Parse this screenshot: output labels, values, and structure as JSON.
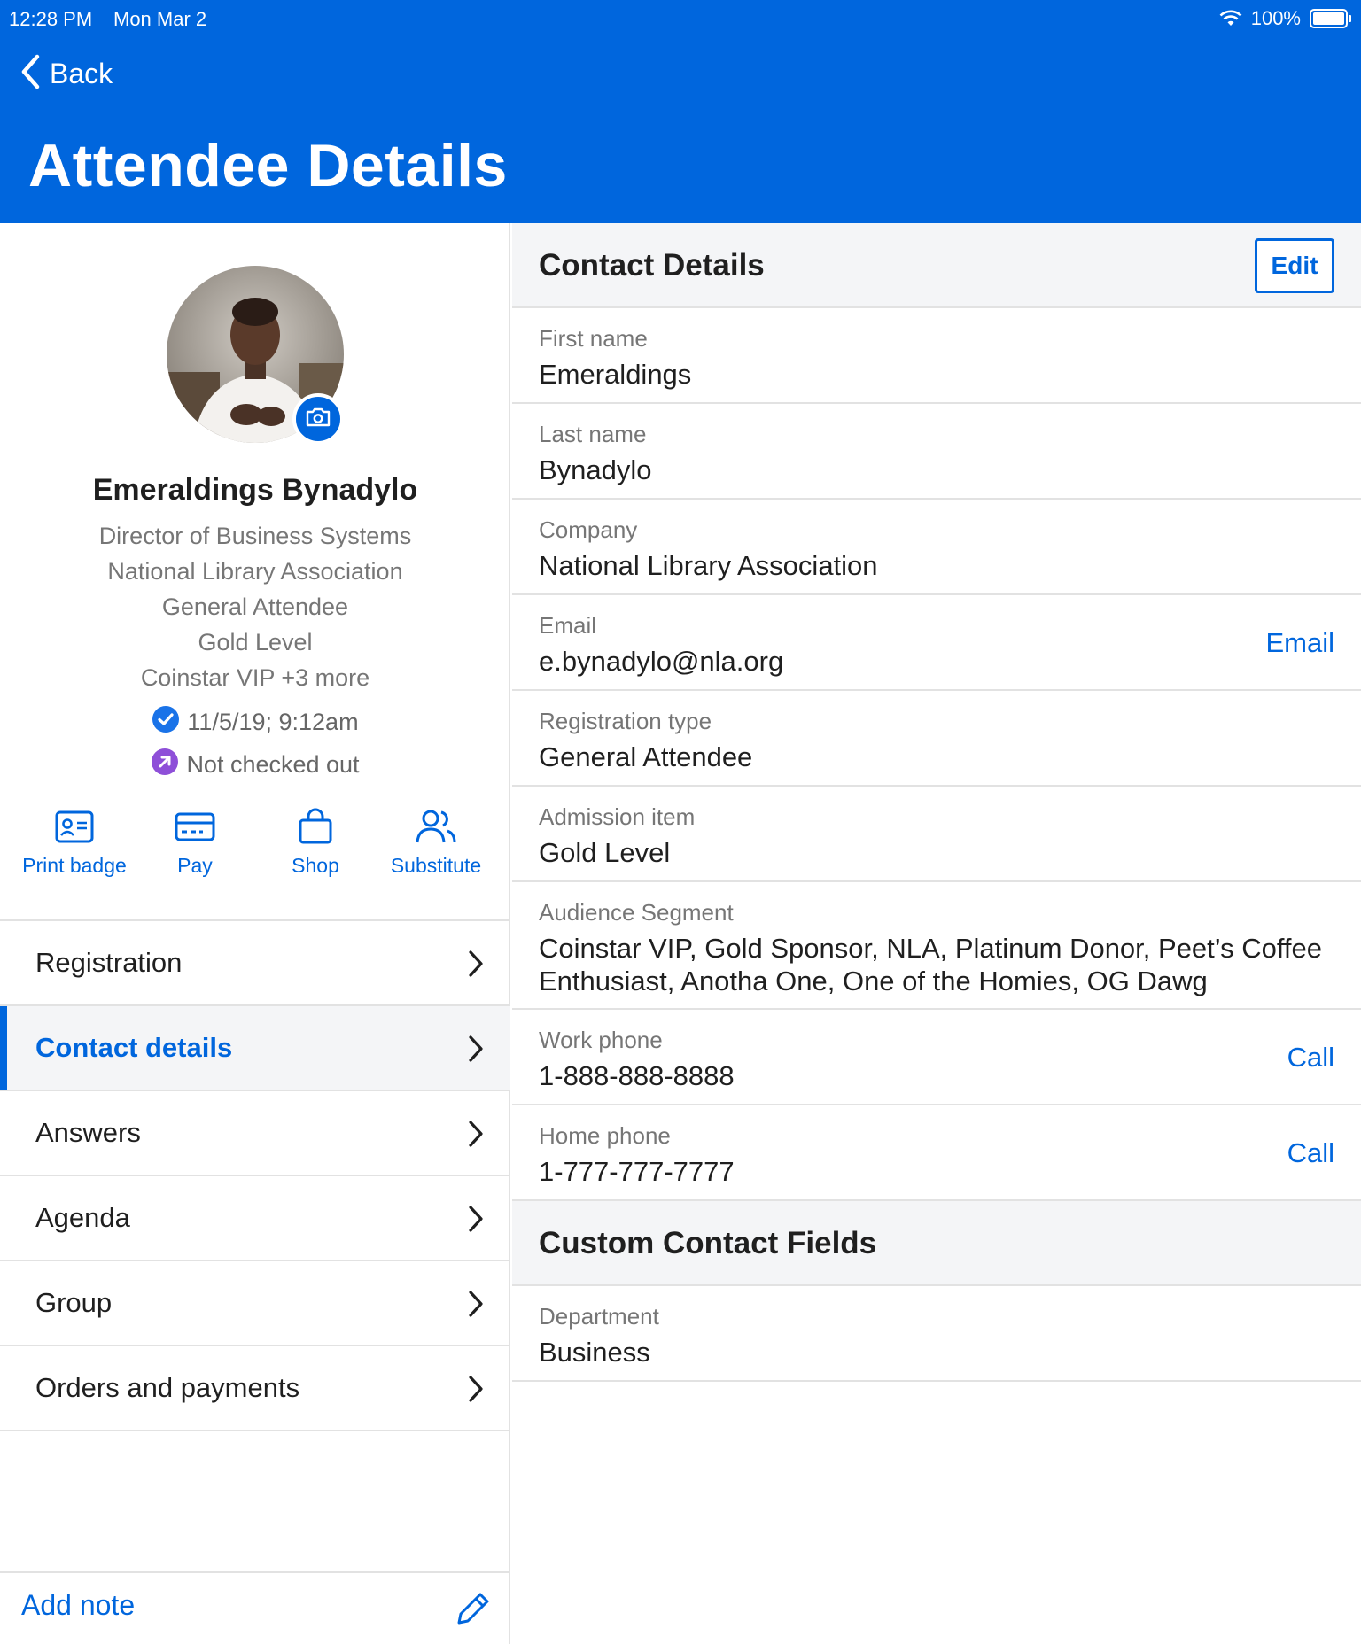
{
  "status_bar": {
    "time": "12:28 PM",
    "date": "Mon Mar 2",
    "battery": "100%"
  },
  "header": {
    "back_label": "Back",
    "title": "Attendee Details"
  },
  "profile": {
    "name": "Emeraldings Bynadylo",
    "job_title": "Director of Business Systems",
    "company": "National Library Association",
    "registration_type": "General Attendee",
    "admission": "Gold Level",
    "segments": "Coinstar VIP +3 more",
    "checked_in": "11/5/19; 9:12am",
    "checked_out": "Not checked out"
  },
  "actions": [
    {
      "label": "Print badge",
      "icon": "badge-icon"
    },
    {
      "label": "Pay",
      "icon": "credit-card-icon"
    },
    {
      "label": "Shop",
      "icon": "shopping-bag-icon"
    },
    {
      "label": "Substitute",
      "icon": "users-icon"
    }
  ],
  "nav": [
    {
      "label": "Registration",
      "active": false
    },
    {
      "label": "Contact details",
      "active": true
    },
    {
      "label": "Answers",
      "active": false
    },
    {
      "label": "Agenda",
      "active": false
    },
    {
      "label": "Group",
      "active": false
    },
    {
      "label": "Orders and payments",
      "active": false
    }
  ],
  "add_note_label": "Add note",
  "contact": {
    "title": "Contact Details",
    "edit_label": "Edit",
    "fields": [
      {
        "label": "First name",
        "value": "Emeraldings"
      },
      {
        "label": "Last name",
        "value": "Bynadylo"
      },
      {
        "label": "Company",
        "value": "National Library Association"
      },
      {
        "label": "Email",
        "value": "e.bynadylo@nla.org",
        "action": "Email"
      },
      {
        "label": "Registration type",
        "value": "General Attendee"
      },
      {
        "label": "Admission item",
        "value": "Gold Level"
      },
      {
        "label": "Audience Segment",
        "value": "Coinstar VIP, Gold Sponsor, NLA, Platinum Donor, Peet’s Coffee Enthusiast, Anotha One, One of the Homies, OG Dawg"
      },
      {
        "label": "Work phone",
        "value": "1-888-888-8888",
        "action": "Call"
      },
      {
        "label": "Home phone",
        "value": "1-777-777-7777",
        "action": "Call"
      }
    ]
  },
  "custom": {
    "title": "Custom Contact Fields",
    "fields": [
      {
        "label": "Department",
        "value": "Business"
      }
    ]
  },
  "colors": {
    "brand": "#0066dd",
    "checkin": "#1a73e8",
    "checkout": "#8e4fd8"
  }
}
